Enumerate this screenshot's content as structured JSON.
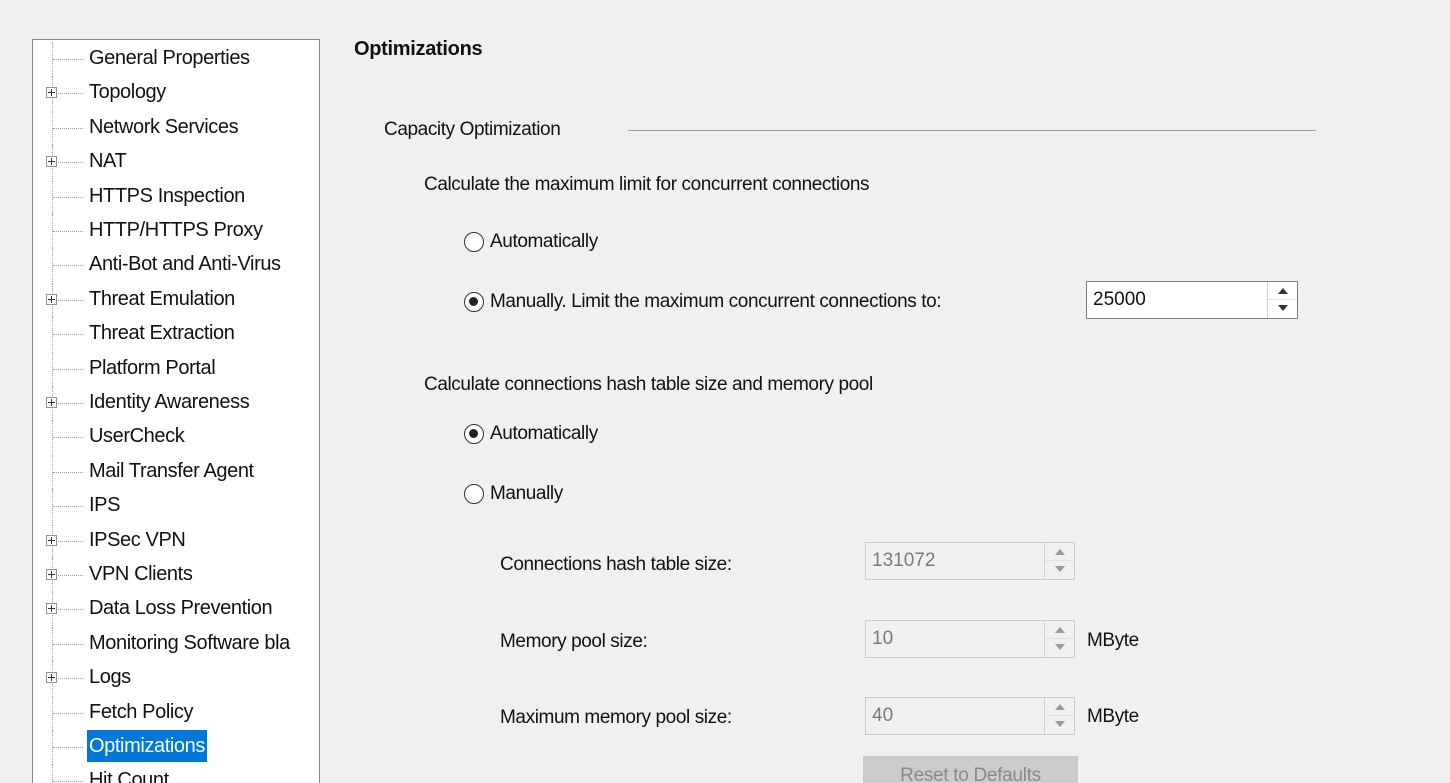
{
  "tree": {
    "items": [
      {
        "label": "General Properties",
        "expandable": false,
        "selected": false
      },
      {
        "label": "Topology",
        "expandable": true,
        "selected": false
      },
      {
        "label": "Network Services",
        "expandable": false,
        "selected": false
      },
      {
        "label": "NAT",
        "expandable": true,
        "selected": false
      },
      {
        "label": "HTTPS Inspection",
        "expandable": false,
        "selected": false
      },
      {
        "label": "HTTP/HTTPS Proxy",
        "expandable": false,
        "selected": false
      },
      {
        "label": "Anti-Bot and Anti-Virus",
        "expandable": false,
        "selected": false
      },
      {
        "label": "Threat Emulation",
        "expandable": true,
        "selected": false
      },
      {
        "label": "Threat Extraction",
        "expandable": false,
        "selected": false
      },
      {
        "label": "Platform Portal",
        "expandable": false,
        "selected": false
      },
      {
        "label": "Identity Awareness",
        "expandable": true,
        "selected": false
      },
      {
        "label": "UserCheck",
        "expandable": false,
        "selected": false
      },
      {
        "label": "Mail Transfer Agent",
        "expandable": false,
        "selected": false
      },
      {
        "label": "IPS",
        "expandable": false,
        "selected": false
      },
      {
        "label": "IPSec VPN",
        "expandable": true,
        "selected": false
      },
      {
        "label": "VPN Clients",
        "expandable": true,
        "selected": false
      },
      {
        "label": "Data Loss Prevention",
        "expandable": true,
        "selected": false
      },
      {
        "label": "Monitoring Software bla",
        "expandable": false,
        "selected": false
      },
      {
        "label": "Logs",
        "expandable": true,
        "selected": false
      },
      {
        "label": "Fetch Policy",
        "expandable": false,
        "selected": false
      },
      {
        "label": "Optimizations",
        "expandable": false,
        "selected": true
      },
      {
        "label": "Hit Count",
        "expandable": false,
        "selected": false
      }
    ]
  },
  "page": {
    "title": "Optimizations",
    "group_label": "Capacity Optimization"
  },
  "max_conn": {
    "heading": "Calculate the maximum limit for concurrent connections",
    "auto_label": "Automatically",
    "manual_label": "Manually. Limit the maximum concurrent connections to:",
    "selected": "manual",
    "value": "25000"
  },
  "hash": {
    "heading": "Calculate connections hash table size and memory pool",
    "auto_label": "Automatically",
    "manual_label": "Manually",
    "selected": "auto",
    "hash_table_label": "Connections hash table size:",
    "hash_table_value": "131072",
    "memory_pool_label": "Memory pool size:",
    "memory_pool_value": "10",
    "memory_pool_unit": "MByte",
    "max_memory_pool_label": "Maximum memory pool size:",
    "max_memory_pool_value": "40",
    "max_memory_pool_unit": "MByte",
    "reset_label": "Reset to Defaults"
  },
  "colors": {
    "selection": "#0078d7",
    "background": "#f0f0f0"
  }
}
